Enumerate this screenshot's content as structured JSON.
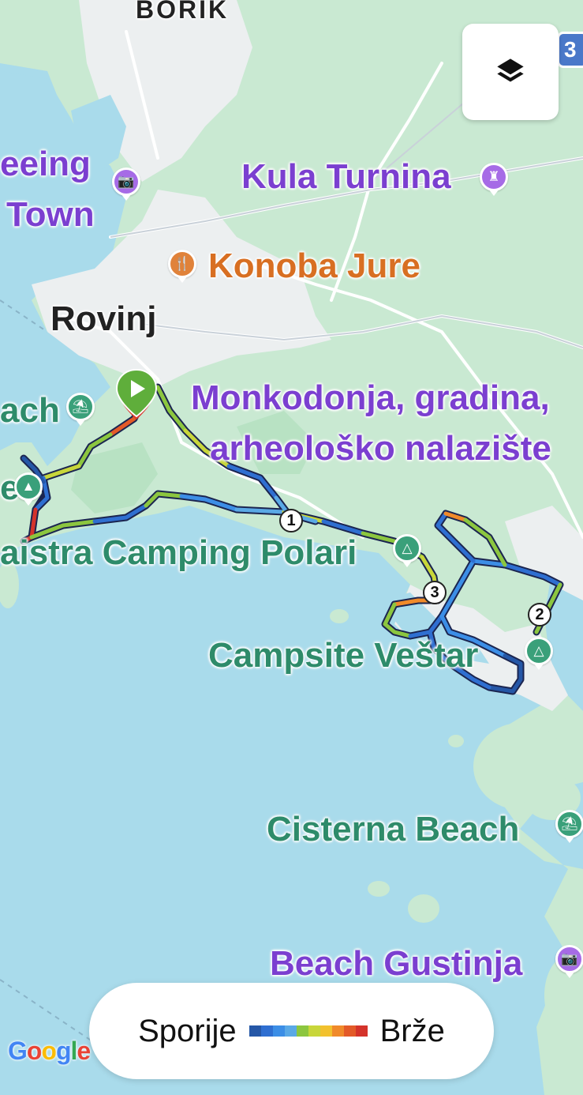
{
  "map": {
    "labels": {
      "borik": "BORIK",
      "sightseeing_line1": "eeing",
      "sightseeing_line2": "Town",
      "kula_turnina": "Kula Turnina",
      "konoba_jure": "Konoba Jure",
      "rovinj": "Rovinj",
      "beach_partial": "ach",
      "monkodonja_line1": "Monkodonja, gradina,",
      "monkodonja_line2": "arheološko nalazište",
      "camping_polari": "aistra Camping Polari",
      "campsite_vestar": "Campsite Veštar",
      "cisterna_beach": "Cisterna Beach",
      "beach_gustinja": "Beach Gustinja",
      "partial_e": "e"
    },
    "road_badge": "3",
    "markers": [
      "1",
      "2",
      "3"
    ],
    "icons": {
      "layers": "layers-icon",
      "start": "play-icon",
      "camera": "camera-icon",
      "tower": "tower-icon",
      "restaurant": "cutlery-icon",
      "beach": "beach-umbrella-icon",
      "tent": "tent-icon",
      "tree": "tree-icon"
    }
  },
  "legend": {
    "slower": "Sporije",
    "faster": "Brže",
    "gradient_colors": [
      "#2557a7",
      "#2f6fd1",
      "#3c8ee6",
      "#5aa9e6",
      "#8cc63f",
      "#c8d63a",
      "#f2c12e",
      "#f08a2a",
      "#e35a28",
      "#d4332b"
    ]
  },
  "attribution": "Google"
}
